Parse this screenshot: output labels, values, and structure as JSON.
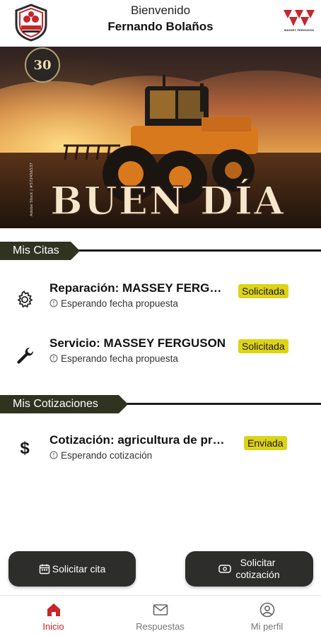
{
  "header": {
    "welcome_line": "Bienvenido",
    "user_name": "Fernando Bolaños",
    "right_brand_text": "MASSEY FERGUSON"
  },
  "banner": {
    "headline": "BUEN DÍA",
    "badge_number": "30",
    "credit": "Adobe Stock | #572456537"
  },
  "sections": {
    "citas_title": "Mis Citas",
    "cotizaciones_title": "Mis Cotizaciones"
  },
  "citas": [
    {
      "icon": "gear-icon",
      "title": "Reparación: MASSEY FERGUSON",
      "status_text": "Esperando fecha propuesta",
      "badge": "Solicitada"
    },
    {
      "icon": "wrench-icon",
      "title": "Servicio: MASSEY FERGUSON",
      "status_text": "Esperando fecha propuesta",
      "badge": "Solicitada"
    }
  ],
  "cotizaciones": [
    {
      "icon": "dollar-icon",
      "title": "Cotización: agricultura de precisión",
      "status_text": "Esperando cotización",
      "badge": "Enviada"
    }
  ],
  "actions": {
    "solicitar_cita": "Solicitar cita",
    "solicitar_cotizacion_line1": "Solicitar",
    "solicitar_cotizacion_line2": "cotización"
  },
  "nav": {
    "inicio": "Inicio",
    "respuestas": "Respuestas",
    "perfil": "Mi perfil"
  },
  "colors": {
    "accent_red": "#c7262b",
    "badge_yellow": "#ddd317",
    "section_tag": "#2f3320",
    "button_dark": "#2d2d2b"
  }
}
